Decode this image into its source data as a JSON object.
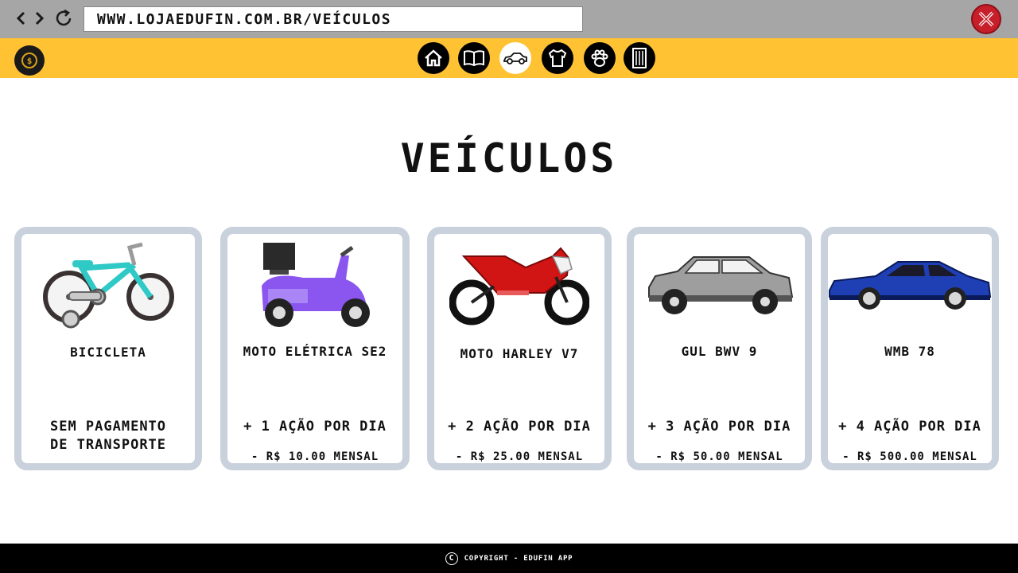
{
  "browser": {
    "url": "WWW.LOJAEDUFIN.COM.BR/VEÍCULOS",
    "close_color": "#c61f2a"
  },
  "header": {
    "background": "#ffc233",
    "logo_icon": "coin-logo",
    "logo_symbol": "$",
    "nav_icons": [
      {
        "name": "home-icon",
        "active": false
      },
      {
        "name": "book-icon",
        "active": false
      },
      {
        "name": "car-icon",
        "active": true
      },
      {
        "name": "shirt-icon",
        "active": false
      },
      {
        "name": "paw-icon",
        "active": false
      },
      {
        "name": "building-icon",
        "active": false
      }
    ]
  },
  "page": {
    "title": "VEÍCULOS"
  },
  "vehicles": [
    {
      "name": "BICICLETA",
      "benefit": "SEM PAGAMENTO",
      "benefit2": "DE TRANSPORTE",
      "price": "",
      "icon": "bicycle-image",
      "color": "#2fc9c6"
    },
    {
      "name": "MOTO ELÉTRICA SE2",
      "benefit": "+ 1 AÇÃO POR DIA",
      "benefit2": "",
      "price": "- R$ 10.00 MENSAL",
      "icon": "scooter-image",
      "color": "#8b55f0"
    },
    {
      "name": "MOTO HARLEY V7",
      "benefit": "+ 2 AÇÃO POR DIA",
      "benefit2": "",
      "price": "- R$ 25.00 MENSAL",
      "icon": "motorcycle-image",
      "color": "#d11414"
    },
    {
      "name": "GUL BWV 9",
      "benefit": "+ 3 AÇÃO POR DIA",
      "benefit2": "",
      "price": "- R$ 50.00 MENSAL",
      "icon": "suv-image",
      "color": "#9e9e9e"
    },
    {
      "name": "WMB 78",
      "benefit": "+ 4 AÇÃO POR DIA",
      "benefit2": "",
      "price": "- R$ 500.00 MENSAL",
      "icon": "sportscar-image",
      "color": "#1f3fb5"
    }
  ],
  "footer": {
    "copyright_symbol": "C",
    "text": "COPYRIGHT - EDUFIN APP"
  }
}
